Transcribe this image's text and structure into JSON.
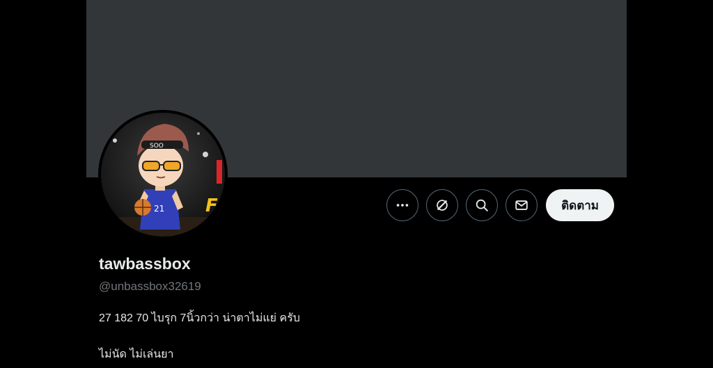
{
  "profile": {
    "display_name": "tawbassbox",
    "handle": "@unbassbox32619",
    "bio_lines": [
      "27 182 70 ไบรุก 7นิ้วกว่า น่าตาไม่แย่ ครับ",
      "ไม่นัด ไม่เล่นยา"
    ]
  },
  "actions": {
    "more_icon": "more-horizontal-icon",
    "grok_icon": "grok-icon",
    "search_icon": "search-icon",
    "message_icon": "envelope-icon",
    "follow_label": "ติดตาม"
  },
  "avatar": {
    "headband_text": "SOO",
    "jersey_number": "21"
  },
  "colors": {
    "background": "#000000",
    "banner": "#333639",
    "text_primary": "#e7e9ea",
    "text_secondary": "#71767b",
    "button_border": "#536471",
    "follow_bg": "#eff3f4",
    "follow_text": "#0f1419"
  }
}
